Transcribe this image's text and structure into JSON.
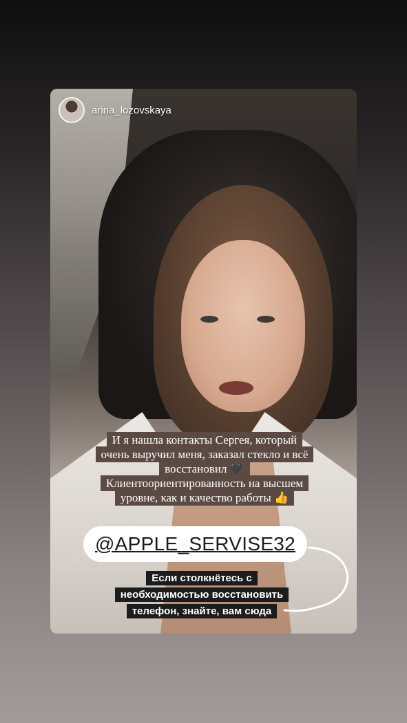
{
  "story": {
    "username": "arina_lozovskaya",
    "caption_lines": [
      "И я нашла контакты Сергея, который",
      "очень выручил меня, заказал стекло и всё",
      "восстановил 🖤",
      "Клиентоориентированность на высшем",
      "уровне, как и качество работы 👍"
    ],
    "mention": "@APPLE_SERVISE32",
    "note_lines": [
      "Если столкнётесь с",
      "необходимостью восстановить",
      "телефон, знайте, вам сюда"
    ]
  },
  "colors": {
    "caption_bg": "#5b4a43",
    "note_bg": "#1c1c1c",
    "mention_bg": "#ffffff"
  },
  "icons": {
    "avatar": "profile-avatar-icon",
    "heart": "black-heart-emoji",
    "thumb": "thumbs-up-emoji",
    "arrow": "curved-arrow-doodle"
  }
}
